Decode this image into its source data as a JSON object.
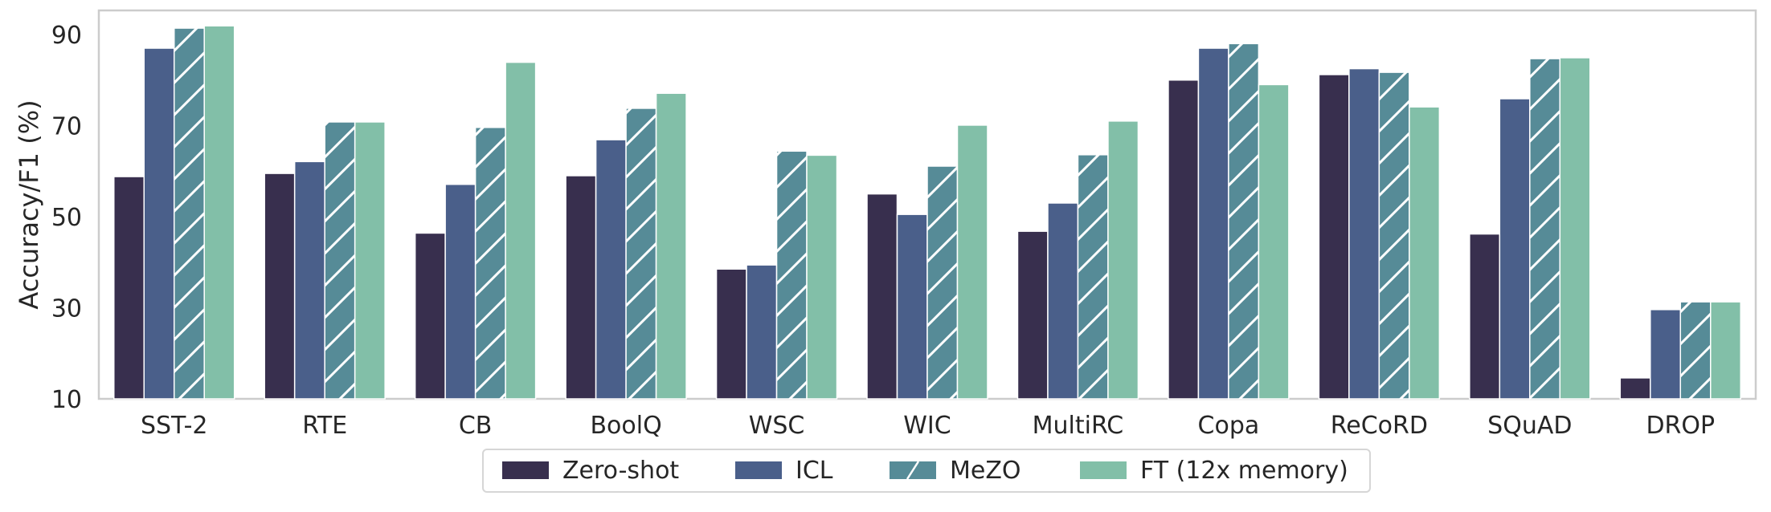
{
  "chart_data": {
    "type": "bar",
    "title": "",
    "xlabel": "",
    "ylabel": "Accuracy/F1 (%)",
    "ylim": [
      10,
      95
    ],
    "yticks": [
      10,
      30,
      50,
      70,
      90
    ],
    "grid": false,
    "legend_position": "bottom-center",
    "categories": [
      "SST-2",
      "RTE",
      "CB",
      "BoolQ",
      "WSC",
      "WIC",
      "MultiRC",
      "Copa",
      "ReCoRD",
      "SQuAD",
      "DROP"
    ],
    "series": [
      {
        "name": "Zero-shot",
        "color": "#382f4e",
        "hatch": false,
        "values": [
          58.8,
          59.5,
          46.4,
          59.0,
          38.5,
          55.0,
          46.8,
          80.0,
          81.2,
          46.2,
          14.6
        ]
      },
      {
        "name": "ICL",
        "color": "#4a5f8a",
        "hatch": false,
        "values": [
          87.0,
          62.1,
          57.1,
          66.9,
          39.4,
          50.5,
          53.0,
          87.0,
          82.5,
          75.9,
          29.6
        ]
      },
      {
        "name": "MeZO",
        "color": "#568b97",
        "hatch": true,
        "values": [
          91.4,
          70.8,
          69.6,
          73.8,
          64.4,
          61.1,
          63.6,
          88.0,
          81.7,
          84.7,
          31.3
        ]
      },
      {
        "name": "FT (12x memory)",
        "color": "#82bfa8",
        "hatch": false,
        "values": [
          91.9,
          70.8,
          83.9,
          77.1,
          63.5,
          70.1,
          71.0,
          79.0,
          74.1,
          84.9,
          31.3
        ]
      }
    ]
  }
}
